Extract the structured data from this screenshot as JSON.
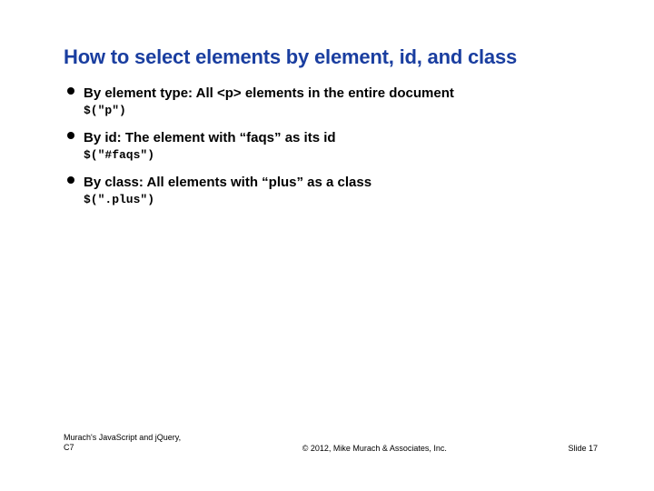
{
  "title": "How to select elements by element, id, and class",
  "sections": [
    {
      "heading": "By element type: All <p> elements in the entire document",
      "code": "$(\"p\")"
    },
    {
      "heading": "By id: The element with “faqs” as its id",
      "code": "$(\"#faqs\")"
    },
    {
      "heading": "By class: All elements with “plus” as a class",
      "code": "$(\".plus\")"
    }
  ],
  "footer": {
    "left_line1": "Murach's JavaScript and jQuery,",
    "left_line2": "C7",
    "center": "© 2012, Mike Murach & Associates, Inc.",
    "right": "Slide 17"
  }
}
